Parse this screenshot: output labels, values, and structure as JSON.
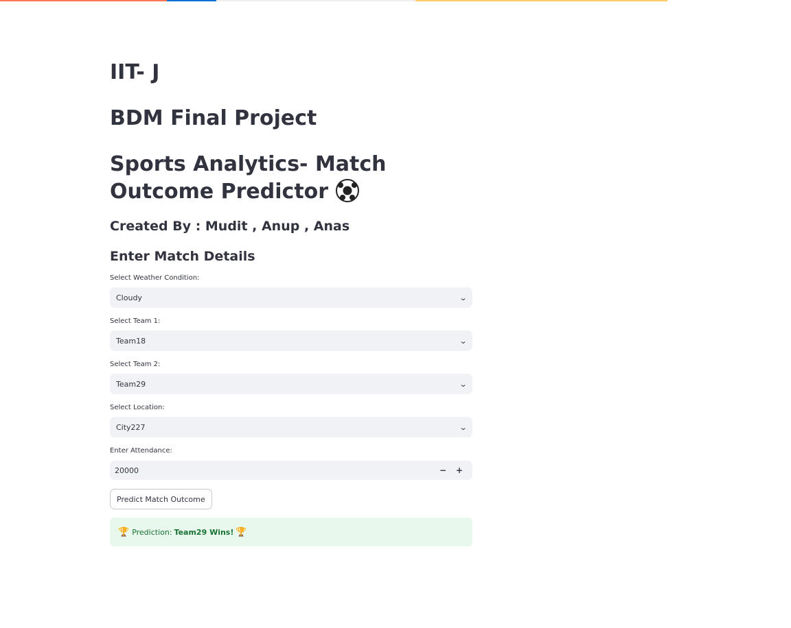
{
  "colors": {
    "topbar": [
      "#ff7452",
      "#0b6fd6",
      "#eeeeee",
      "#ffcc66"
    ],
    "text": "#31333f",
    "input_bg": "#f0f2f6",
    "success_bg": "#e8f8ec",
    "success_text": "#177233"
  },
  "header": {
    "title1": "IIT- J",
    "title2": "BDM Final Project",
    "title3": "Sports Analytics- Match Outcome Predictor",
    "title3_icon": "soccer-ball-icon",
    "created_by": "Created By : Mudit , Anup , Anas",
    "section": "Enter Match Details"
  },
  "form": {
    "weather": {
      "label": "Select Weather Condition:",
      "value": "Cloudy"
    },
    "team1": {
      "label": "Select Team 1:",
      "value": "Team18"
    },
    "team2": {
      "label": "Select Team 2:",
      "value": "Team29"
    },
    "location": {
      "label": "Select Location:",
      "value": "City227"
    },
    "attendance": {
      "label": "Enter Attendance:",
      "value": "20000",
      "minus": "−",
      "plus": "+"
    },
    "predict_button": "Predict Match Outcome"
  },
  "result": {
    "prefix": "Prediction:",
    "text": "Team29 Wins!",
    "icon": "trophy-icon"
  }
}
